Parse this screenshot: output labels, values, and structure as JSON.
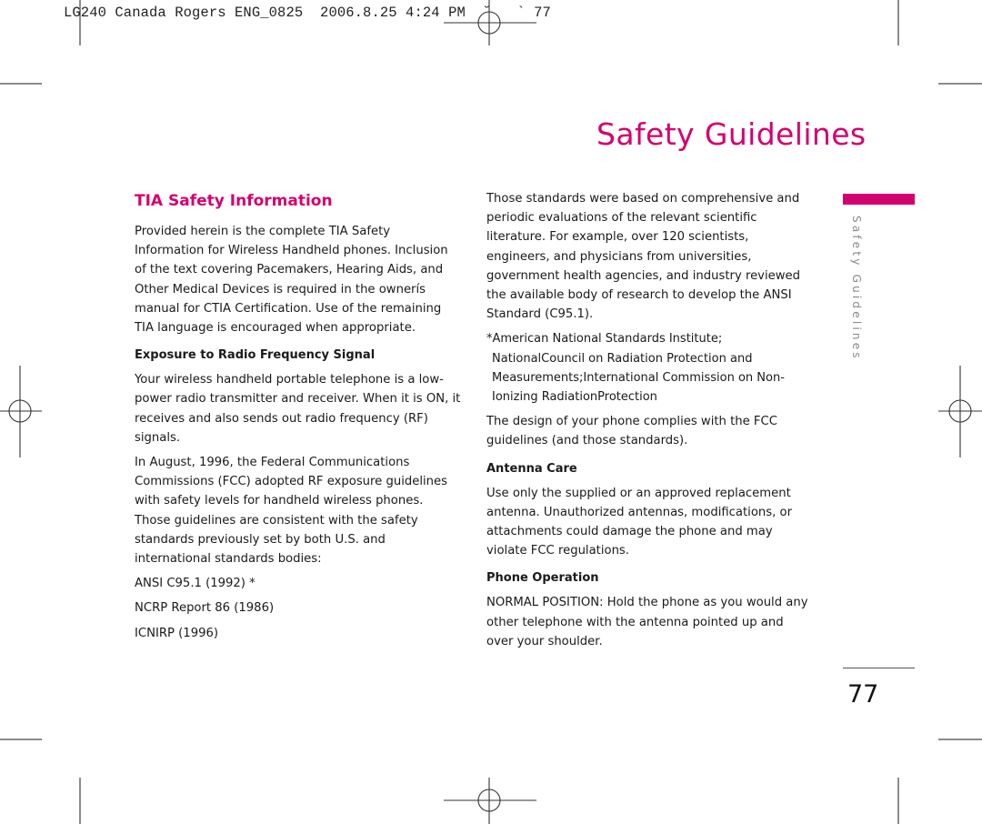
{
  "slug_line": "LG240 Canada Rogers ENG_0825  2006.8.25 4:24 PM  ˘   ` 77",
  "page_title": "Safety Guidelines",
  "side_tab": {
    "label": "Safety Guidelines",
    "accent_color": "#d4006f"
  },
  "page_number": "77",
  "left_column": {
    "section_title": "TIA Safety Information",
    "intro": "Provided herein is the complete TIA Safety Information for Wireless Handheld phones. Inclusion of the text covering Pacemakers, Hearing Aids, and Other Medical Devices is required in the ownerís manual for CTIA Certification. Use of the remaining TIA language is encouraged when appropriate.",
    "rf_heading": "Exposure to Radio Frequency Signal",
    "rf_paragraph": "Your wireless handheld portable telephone is a low-power radio transmitter and receiver. When it is ON, it receives and also sends out radio frequency (RF) signals.",
    "fcc_paragraph": "In August, 1996, the Federal Communications Commissions (FCC) adopted RF exposure guidelines with safety levels for handheld wireless phones. Those guidelines are consistent with the safety standards previously set by both U.S. and international standards bodies:",
    "standards": [
      "ANSI C95.1 (1992) *",
      "NCRP Report 86 (1986)",
      "ICNIRP (1996)"
    ]
  },
  "right_column": {
    "standards_paragraph": "Those standards were based on comprehensive and periodic evaluations of the relevant scientific literature. For example, over 120 scientists, engineers, and physicians from universities, government health agencies, and industry reviewed the available body of research to develop the ANSI Standard (C95.1).",
    "footnote": "*American National Standards Institute; NationalCouncil on Radiation Protection and Measurements;International Commission on Non-Ionizing RadiationProtection",
    "compliance_paragraph": "The design of your phone complies with the FCC guidelines (and those standards).",
    "antenna_heading": "Antenna Care",
    "antenna_paragraph": "Use only the supplied or an approved replacement antenna. Unauthorized antennas, modifications, or attachments could damage the phone and may violate FCC regulations.",
    "operation_heading": "Phone Operation",
    "operation_paragraph": "NORMAL POSITION: Hold the phone as you would any other telephone with the antenna pointed up and over your shoulder."
  }
}
